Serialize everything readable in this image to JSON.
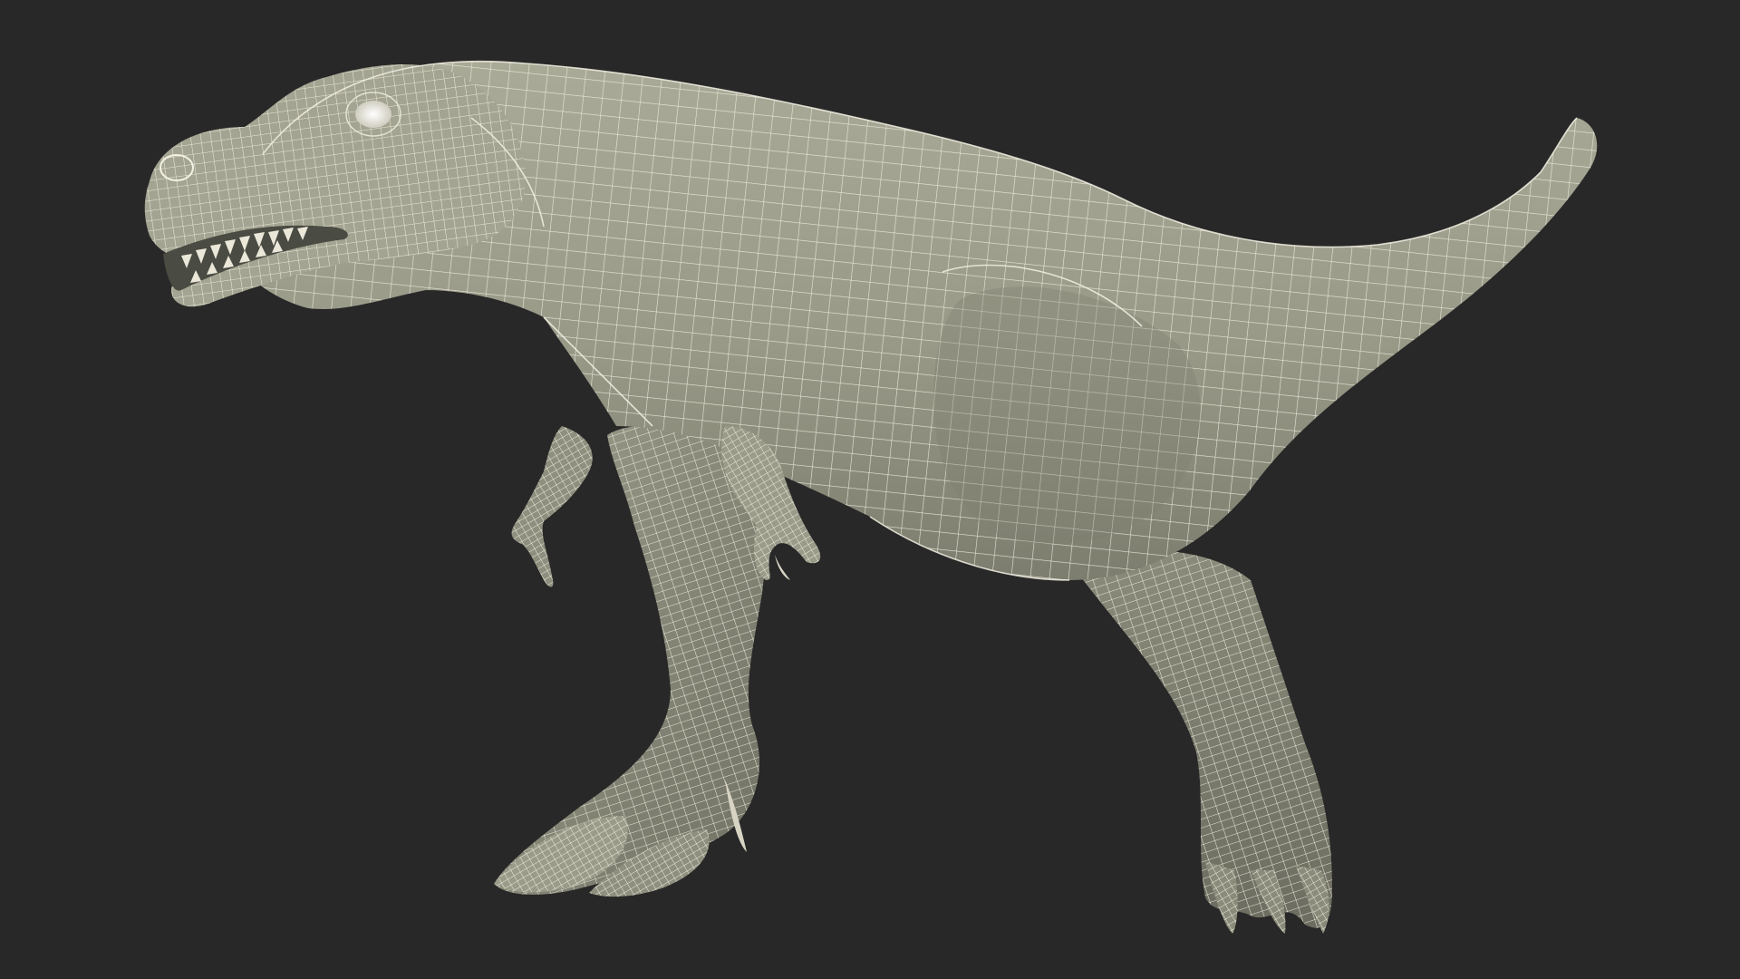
{
  "scene": {
    "subject": "t-rex-wireframe-model",
    "render_style": "wireframe",
    "colors": {
      "background": "#282828",
      "surface_light": "#a7a895",
      "surface_mid": "#8b8c7b",
      "surface_dark": "#6a6b5e",
      "wire": "#f3f1e4",
      "claw": "#d8d4c4"
    }
  }
}
